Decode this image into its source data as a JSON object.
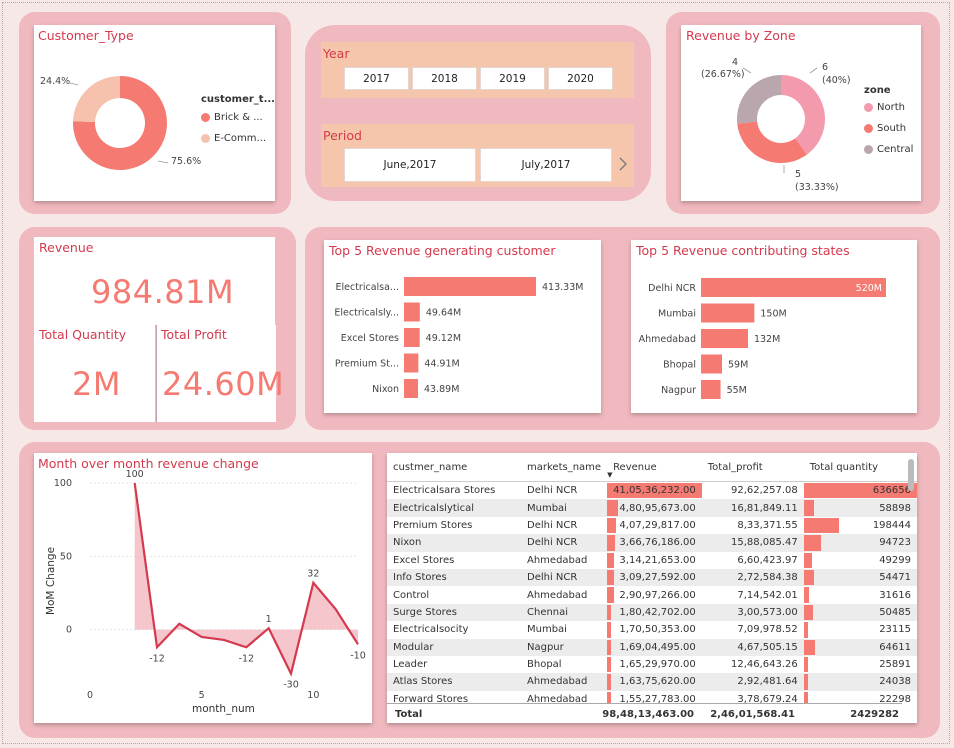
{
  "colors": {
    "accent": "#d43a4e",
    "bar": "#f47a72",
    "panel": "#f0b9bf",
    "slicer": "#f5c6ab",
    "north": "#f49aad",
    "south": "#f47a72",
    "central": "#b9a7ad"
  },
  "customer_type": {
    "title": "Customer_Type",
    "legend_title": "customer_t...",
    "legend": [
      "Brick & ...",
      "E-Comm..."
    ],
    "labels": [
      "75.6%",
      "24.4%"
    ],
    "chart_data": {
      "type": "pie",
      "categories": [
        "Brick & Mortar",
        "E-Commerce"
      ],
      "values": [
        75.6,
        24.4
      ]
    }
  },
  "year_slicer": {
    "title": "Year",
    "options": [
      "2017",
      "2018",
      "2019",
      "2020"
    ]
  },
  "period_slicer": {
    "title": "Period",
    "options": [
      "June,2017",
      "July,2017"
    ],
    "next_icon": "chevron-right-icon"
  },
  "zone": {
    "title": "Revenue by Zone",
    "legend_title": "zone",
    "legend": [
      "North",
      "South",
      "Central"
    ],
    "labels": {
      "north_count": "6",
      "north_pct": "(40%)",
      "south_count": "5",
      "south_pct": "(33.33%)",
      "central_count": "4",
      "central_pct": "(26.67%)"
    },
    "chart_data": {
      "type": "pie",
      "categories": [
        "North",
        "South",
        "Central"
      ],
      "values": [
        6,
        5,
        4
      ]
    }
  },
  "kpi": {
    "revenue_title": "Revenue",
    "revenue_value": "984.81M",
    "qty_title": "Total Quantity",
    "qty_value": "2M",
    "profit_title": "Total Profit",
    "profit_value": "24.60M"
  },
  "top_customers": {
    "title": "Top 5 Revenue generating customer",
    "chart_data": {
      "type": "bar",
      "categories": [
        "Electricalsa...",
        "Electricalsly...",
        "Excel Stores",
        "Premium St...",
        "Nixon"
      ],
      "values": [
        413.33,
        49.64,
        49.12,
        44.91,
        43.89
      ],
      "labels": [
        "413.33M",
        "49.64M",
        "49.12M",
        "44.91M",
        "43.89M"
      ]
    }
  },
  "top_states": {
    "title": "Top 5 Revenue contributing states",
    "chart_data": {
      "type": "bar",
      "categories": [
        "Delhi NCR",
        "Mumbai",
        "Ahmedabad",
        "Bhopal",
        "Nagpur"
      ],
      "values": [
        520,
        150,
        132,
        59,
        55
      ],
      "labels": [
        "520M",
        "150M",
        "132M",
        "59M",
        "55M"
      ]
    }
  },
  "mom": {
    "title": "Month over month revenue change",
    "chart_data": {
      "type": "area",
      "xlabel": "month_num",
      "ylabel": "MoM Change",
      "xlim": [
        0,
        12
      ],
      "ylim": [
        -20,
        100
      ],
      "x_ticks": [
        "0",
        "5",
        "10"
      ],
      "y_ticks": [
        "100",
        "50",
        "0"
      ],
      "x": [
        2,
        3,
        4,
        5,
        6,
        7,
        8,
        9,
        10,
        11,
        12
      ],
      "values": [
        100,
        -12,
        4,
        -5,
        -7,
        -12,
        1,
        -30,
        32,
        14,
        -10
      ],
      "data_labels": [
        "100",
        "-12",
        "",
        "",
        "",
        "-12",
        "1",
        "-30",
        "32",
        "",
        "-10"
      ]
    }
  },
  "table": {
    "headers": [
      "custmer_name",
      "markets_name",
      "Revenue",
      "Total_profit",
      "Total quantity"
    ],
    "rows": [
      {
        "name": "Electricalsara Stores",
        "market": "Delhi NCR",
        "revenue": "41,05,36,232.00",
        "profit": "92,62,257.08",
        "qty": "636656",
        "rev_frac": 1.0,
        "qty_frac": 1.0
      },
      {
        "name": "Electricalslytical",
        "market": "Mumbai",
        "revenue": "4,80,95,673.00",
        "profit": "16,81,849.11",
        "qty": "58898",
        "rev_frac": 0.117,
        "qty_frac": 0.093
      },
      {
        "name": "Premium Stores",
        "market": "Delhi NCR",
        "revenue": "4,07,29,817.00",
        "profit": "8,33,371.55",
        "qty": "198444",
        "rev_frac": 0.099,
        "qty_frac": 0.312
      },
      {
        "name": "Nixon",
        "market": "Delhi NCR",
        "revenue": "3,66,76,186.00",
        "profit": "15,88,085.47",
        "qty": "94723",
        "rev_frac": 0.089,
        "qty_frac": 0.149
      },
      {
        "name": "Excel Stores",
        "market": "Ahmedabad",
        "revenue": "3,14,21,653.00",
        "profit": "6,60,423.97",
        "qty": "49299",
        "rev_frac": 0.077,
        "qty_frac": 0.077
      },
      {
        "name": "Info Stores",
        "market": "Delhi NCR",
        "revenue": "3,09,27,592.00",
        "profit": "2,72,584.38",
        "qty": "54471",
        "rev_frac": 0.075,
        "qty_frac": 0.086
      },
      {
        "name": "Control",
        "market": "Ahmedabad",
        "revenue": "2,90,97,266.00",
        "profit": "7,14,542.01",
        "qty": "31616",
        "rev_frac": 0.071,
        "qty_frac": 0.05
      },
      {
        "name": "Surge Stores",
        "market": "Chennai",
        "revenue": "1,80,42,702.00",
        "profit": "3,00,573.00",
        "qty": "50485",
        "rev_frac": 0.044,
        "qty_frac": 0.079
      },
      {
        "name": "Electricalsocity",
        "market": "Mumbai",
        "revenue": "1,70,50,353.00",
        "profit": "7,09,978.52",
        "qty": "23115",
        "rev_frac": 0.042,
        "qty_frac": 0.036
      },
      {
        "name": "Modular",
        "market": "Nagpur",
        "revenue": "1,69,04,495.00",
        "profit": "4,67,505.15",
        "qty": "64611",
        "rev_frac": 0.041,
        "qty_frac": 0.101
      },
      {
        "name": "Leader",
        "market": "Bhopal",
        "revenue": "1,65,29,970.00",
        "profit": "12,46,643.26",
        "qty": "25891",
        "rev_frac": 0.04,
        "qty_frac": 0.041
      },
      {
        "name": "Atlas Stores",
        "market": "Ahmedabad",
        "revenue": "1,63,75,620.00",
        "profit": "2,92,481.64",
        "qty": "24038",
        "rev_frac": 0.04,
        "qty_frac": 0.038
      },
      {
        "name": "Forward Stores",
        "market": "Ahmedabad",
        "revenue": "1,55,27,783.00",
        "profit": "3,78,679.24",
        "qty": "22298",
        "rev_frac": 0.038,
        "qty_frac": 0.035
      }
    ],
    "total": {
      "label": "Total",
      "revenue": "98,48,13,463.00",
      "profit": "2,46,01,568.41",
      "qty": "2429282"
    }
  }
}
